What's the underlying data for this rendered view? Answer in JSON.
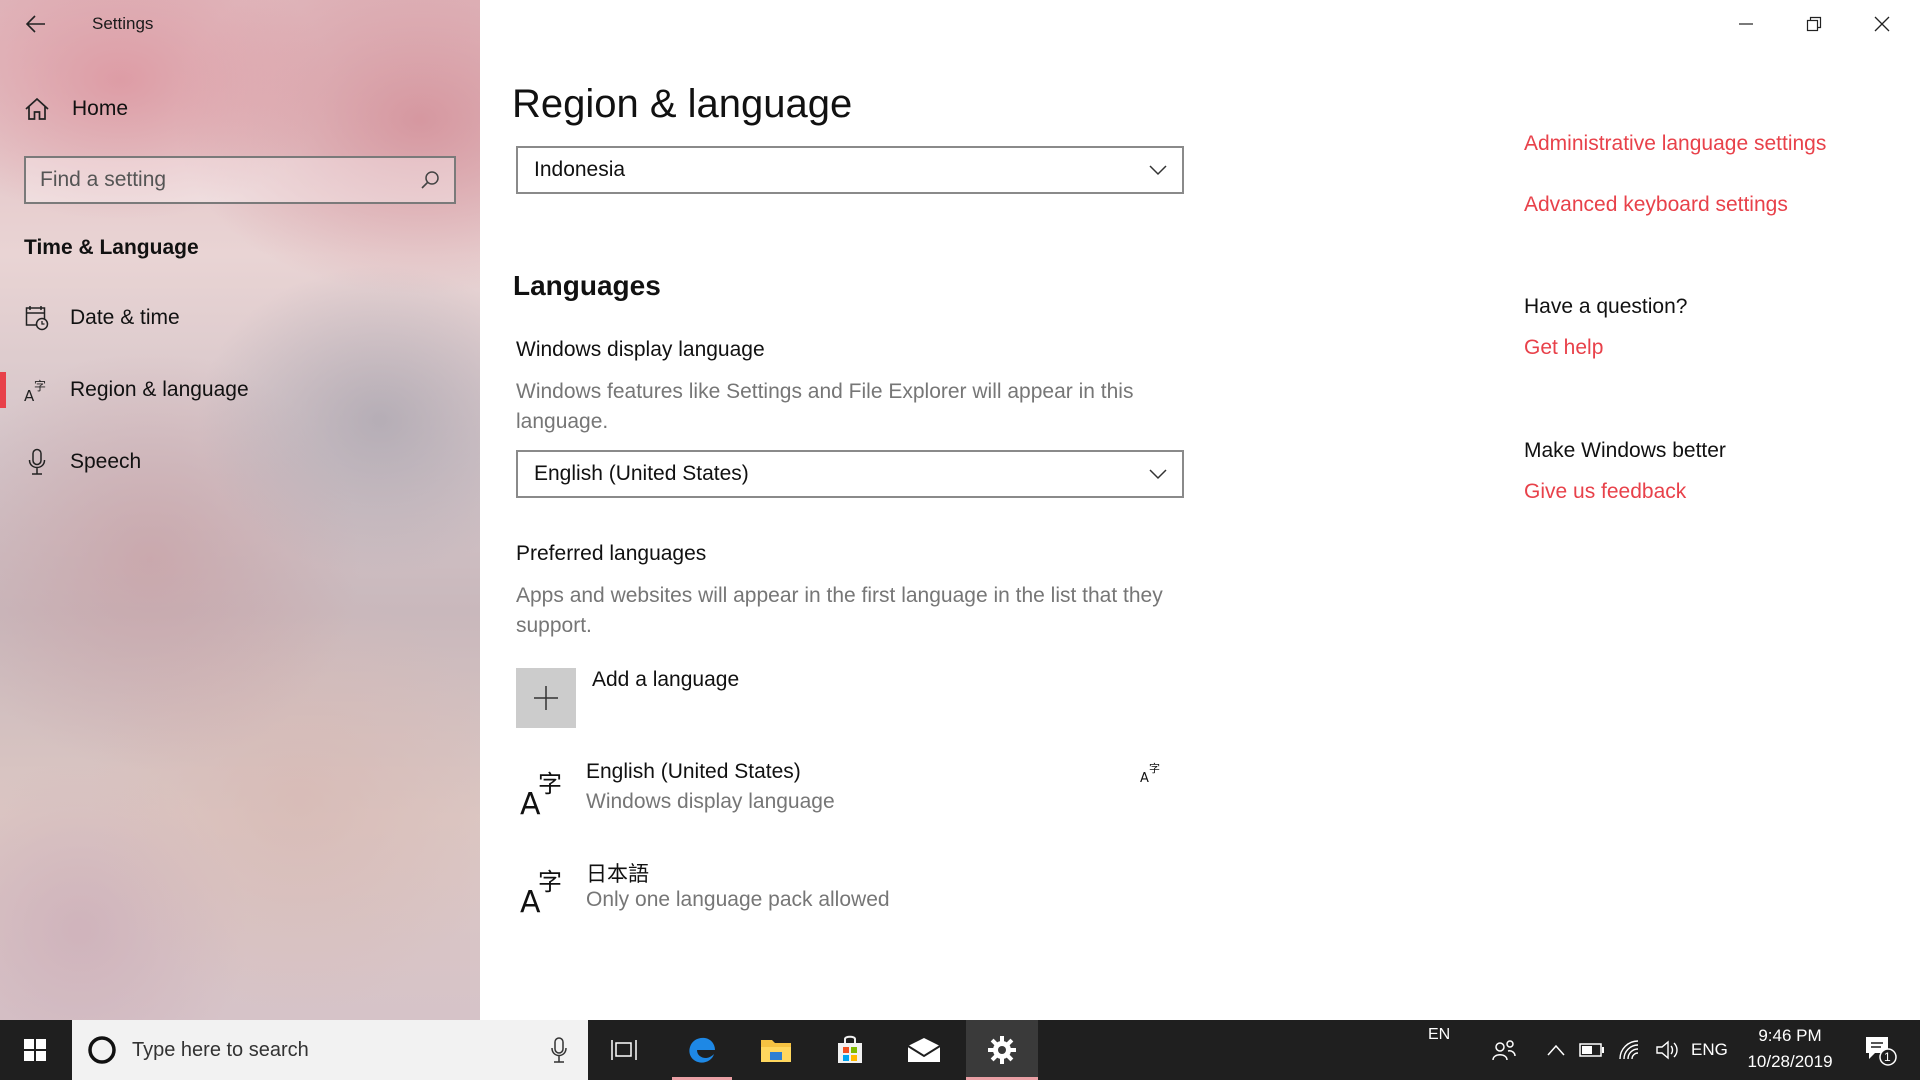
{
  "app": {
    "title": "Settings"
  },
  "sidebar": {
    "home_label": "Home",
    "search_placeholder": "Find a setting",
    "section": "Time & Language",
    "items": [
      {
        "label": "Date & time",
        "icon": "calendar-clock-icon",
        "active": false
      },
      {
        "label": "Region & language",
        "icon": "language-icon",
        "active": true
      },
      {
        "label": "Speech",
        "icon": "microphone-icon",
        "active": false
      }
    ]
  },
  "main": {
    "title": "Region & language",
    "region_value": "Indonesia",
    "languages_heading": "Languages",
    "display_language": {
      "heading": "Windows display language",
      "description": "Windows features like Settings and File Explorer will appear in this language.",
      "value": "English (United States)"
    },
    "preferred": {
      "heading": "Preferred languages",
      "description": "Apps and websites will appear in the first language in the list that they support.",
      "add_label": "Add a language",
      "languages": [
        {
          "name": "English (United States)",
          "sub": "Windows display language"
        },
        {
          "name": "日本語",
          "sub": "Only one language pack allowed"
        }
      ]
    }
  },
  "related": {
    "admin_link": "Administrative language settings",
    "keyboard_link": "Advanced keyboard settings",
    "question_heading": "Have a question?",
    "help_link": "Get help",
    "better_heading": "Make Windows better",
    "feedback_link": "Give us feedback"
  },
  "taskbar": {
    "search_placeholder": "Type here to search",
    "input_indicator": "EN",
    "lang_indicator": "ENG",
    "time": "9:46 PM",
    "date": "10/28/2019",
    "notification_count": "1"
  },
  "colors": {
    "accent": "#e8414a",
    "taskbar": "#1f1f1f",
    "secondary_text": "#767676"
  }
}
